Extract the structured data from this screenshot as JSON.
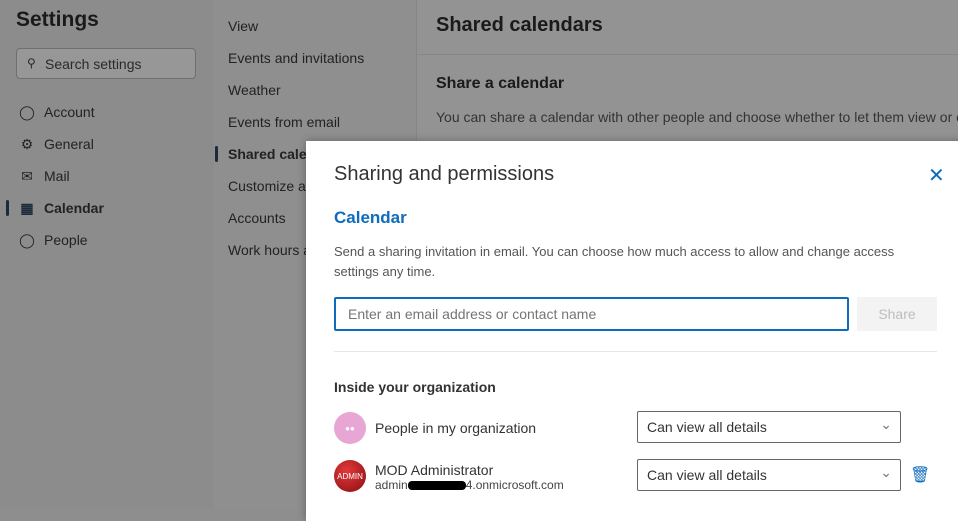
{
  "settings": {
    "title": "Settings",
    "search_placeholder": "Search settings",
    "nav": [
      {
        "label": "Account",
        "icon": "person-icon"
      },
      {
        "label": "General",
        "icon": "gear-icon"
      },
      {
        "label": "Mail",
        "icon": "mail-icon"
      },
      {
        "label": "Calendar",
        "icon": "calendar-icon",
        "active": true
      },
      {
        "label": "People",
        "icon": "people-icon"
      }
    ],
    "sub": [
      "View",
      "Events and invitations",
      "Weather",
      "Events from email",
      "Shared calendars",
      "Customize actions",
      "Accounts",
      "Work hours and location"
    ]
  },
  "main": {
    "title": "Shared calendars",
    "section": "Share a calendar",
    "description": "You can share a calendar with other people and choose whether to let them view or e"
  },
  "dialog": {
    "title": "Sharing and permissions",
    "calendar": "Calendar",
    "description": "Send a sharing invitation in email. You can choose how much access to allow and change access settings any time.",
    "email_placeholder": "Enter an email address or contact name",
    "share_label": "Share",
    "inside_heading": "Inside your organization",
    "people": [
      {
        "name": "People in my organization",
        "permission": "Can view all details",
        "avatar_color": "#e8a6d4"
      },
      {
        "name": "MOD Administrator",
        "email_prefix": "admin",
        "email_suffix": "4.onmicrosoft.com",
        "permission": "Can view all details",
        "avatar_label": "ADMIN",
        "avatar_color": "#a0141c"
      }
    ]
  },
  "colors": {
    "accent": "#0f6cbd"
  }
}
